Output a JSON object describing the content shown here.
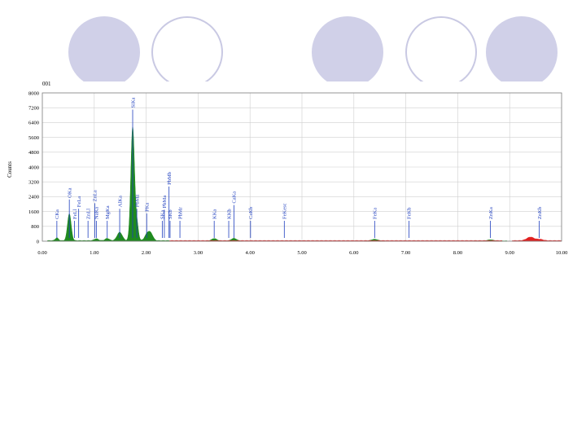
{
  "colors": {
    "circle_fill": "#d0d0e8",
    "circle_stroke": "#c9c9e3",
    "spectrum_green": "#1f8a1f",
    "spectrum_red": "#e02020",
    "label_blue": "#1f3fbf",
    "grid": "#cfcfcf"
  },
  "chart_data": {
    "type": "area",
    "title": "001",
    "ylabel": "Counts",
    "xlabel": "",
    "xlim": [
      0,
      10
    ],
    "ylim": [
      0,
      8000
    ],
    "grid": true,
    "x_ticks": [
      "0.00",
      "1.00",
      "2.00",
      "3.00",
      "4.00",
      "5.00",
      "6.00",
      "7.00",
      "8.00",
      "9.00",
      "10.00"
    ],
    "y_ticks": [
      "0",
      "800",
      "1600",
      "2400",
      "3200",
      "4000",
      "4800",
      "5600",
      "6400",
      "7200",
      "8000"
    ],
    "series": [
      {
        "color": "#1f8a1f",
        "peaks": [
          {
            "x": 0.28,
            "h": 150,
            "w": 0.03
          },
          {
            "x": 0.52,
            "h": 1450,
            "w": 0.035
          },
          {
            "x": 1.04,
            "h": 100,
            "w": 0.04
          },
          {
            "x": 1.25,
            "h": 120,
            "w": 0.04
          },
          {
            "x": 1.49,
            "h": 450,
            "w": 0.05
          },
          {
            "x": 1.74,
            "h": 6100,
            "w": 0.035
          },
          {
            "x": 1.82,
            "h": 900,
            "w": 0.03
          },
          {
            "x": 2.03,
            "h": 420,
            "w": 0.05
          },
          {
            "x": 2.1,
            "h": 250,
            "w": 0.04
          },
          {
            "x": 3.31,
            "h": 130,
            "w": 0.05
          },
          {
            "x": 3.69,
            "h": 140,
            "w": 0.05
          },
          {
            "x": 6.4,
            "h": 90,
            "w": 0.06
          },
          {
            "x": 8.63,
            "h": 60,
            "w": 0.06
          }
        ],
        "background": 40
      },
      {
        "color": "#e02020",
        "segments": [
          [
            2.45,
            8.85
          ],
          [
            9.05,
            10.0
          ]
        ],
        "peaks": [
          {
            "x": 9.4,
            "h": 190,
            "w": 0.07
          },
          {
            "x": 9.58,
            "h": 70,
            "w": 0.06
          }
        ],
        "background": 40
      }
    ],
    "annotations": [
      {
        "label": "CKa",
        "x": 0.28,
        "y": 1100
      },
      {
        "label": "OKa",
        "x": 0.52,
        "y": 2250
      },
      {
        "label": "FeLl",
        "x": 0.62,
        "y": 1100
      },
      {
        "label": "FeLa",
        "x": 0.7,
        "y": 1750
      },
      {
        "label": "ZnLl",
        "x": 0.88,
        "y": 1100
      },
      {
        "label": "NaKa",
        "x": 1.04,
        "y": 1100
      },
      {
        "label": "ZnLa",
        "x": 1.01,
        "y": 2050
      },
      {
        "label": "MgKa",
        "x": 1.25,
        "y": 1100
      },
      {
        "label": "AlKa",
        "x": 1.49,
        "y": 1750
      },
      {
        "label": "SiKa",
        "x": 1.74,
        "y": 7100
      },
      {
        "label": "PbMz",
        "x": 1.82,
        "y": 1750
      },
      {
        "label": "PKa",
        "x": 2.01,
        "y": 1500
      },
      {
        "label": "SKa",
        "x": 2.31,
        "y": 1100
      },
      {
        "label": "PbMa",
        "x": 2.35,
        "y": 1700
      },
      {
        "label": "SKb",
        "x": 2.46,
        "y": 1100
      },
      {
        "label": "PbMb",
        "x": 2.44,
        "y": 2950
      },
      {
        "label": "PbMr",
        "x": 2.65,
        "y": 1100
      },
      {
        "label": "KKa",
        "x": 3.31,
        "y": 1100
      },
      {
        "label": "KKb",
        "x": 3.59,
        "y": 1100
      },
      {
        "label": "CaKa",
        "x": 3.69,
        "y": 1950
      },
      {
        "label": "CaKb",
        "x": 4.01,
        "y": 1100
      },
      {
        "label": "FeKesc",
        "x": 4.66,
        "y": 1100
      },
      {
        "label": "FeKa",
        "x": 6.4,
        "y": 1100
      },
      {
        "label": "FeKb",
        "x": 7.06,
        "y": 1100
      },
      {
        "label": "ZnKa",
        "x": 8.63,
        "y": 1100
      },
      {
        "label": "ZnKb",
        "x": 9.57,
        "y": 1100
      }
    ]
  }
}
